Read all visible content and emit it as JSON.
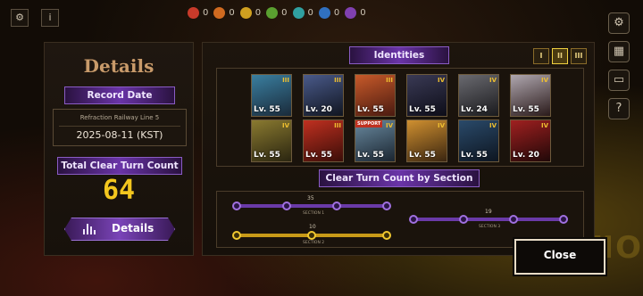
{
  "topbar": {
    "info_label": "i",
    "resources": [
      {
        "icon": "red-gem-icon",
        "value": "0",
        "color": "#c83a2a"
      },
      {
        "icon": "orange-cat-icon",
        "value": "0",
        "color": "#d06a20"
      },
      {
        "icon": "yellow-orb-icon",
        "value": "0",
        "color": "#d0a020"
      },
      {
        "icon": "green-orb-icon",
        "value": "0",
        "color": "#5aa030"
      },
      {
        "icon": "teal-orb-icon",
        "value": "0",
        "color": "#30a0a0"
      },
      {
        "icon": "blue-orb-icon",
        "value": "0",
        "color": "#3070c0"
      },
      {
        "icon": "purple-orb-icon",
        "value": "0",
        "color": "#8040b0"
      }
    ]
  },
  "left": {
    "title": "Details",
    "record_date_label": "Record Date",
    "record_location": "Refraction Railway Line 5",
    "record_date": "2025-08-11 (KST)",
    "total_clear_label": "Total Clear Turn Count",
    "total_clear_value": "64",
    "details_button": "Details"
  },
  "right": {
    "identities_label": "Identities",
    "tiers": [
      "I",
      "II",
      "III"
    ],
    "active_tier": 1,
    "identities": [
      {
        "level": "Lv. 55",
        "rank": "III",
        "support": "",
        "colors": [
          "#3a7fa0",
          "#1a2a3a"
        ]
      },
      {
        "level": "Lv. 20",
        "rank": "III",
        "support": "",
        "colors": [
          "#4a5a8a",
          "#101520"
        ]
      },
      {
        "level": "Lv. 55",
        "rank": "III",
        "support": "",
        "colors": [
          "#c85a2a",
          "#4a1a10"
        ]
      },
      {
        "level": "Lv. 55",
        "rank": "IV",
        "support": "",
        "colors": [
          "#3a3a55",
          "#0d0d18"
        ]
      },
      {
        "level": "Lv. 24",
        "rank": "IV",
        "support": "",
        "colors": [
          "#6a6a70",
          "#1a1a1d"
        ]
      },
      {
        "level": "Lv. 55",
        "rank": "IV",
        "support": "",
        "colors": [
          "#b0a8b0",
          "#2a1a1a"
        ]
      },
      {
        "level": "Lv. 55",
        "rank": "IV",
        "support": "",
        "colors": [
          "#8a7a30",
          "#2a2510"
        ]
      },
      {
        "level": "Lv. 55",
        "rank": "III",
        "support": "",
        "colors": [
          "#c03020",
          "#3a0d08"
        ]
      },
      {
        "level": "Lv. 55",
        "rank": "IV",
        "support": "SUPPORT",
        "colors": [
          "#6a8aa0",
          "#1a2530"
        ]
      },
      {
        "level": "Lv. 55",
        "rank": "IV",
        "support": "",
        "colors": [
          "#d09030",
          "#3a2510"
        ]
      },
      {
        "level": "Lv. 55",
        "rank": "IV",
        "support": "",
        "colors": [
          "#2a4a6a",
          "#0d1520"
        ]
      },
      {
        "level": "Lv. 20",
        "rank": "IV",
        "support": "",
        "colors": [
          "#a02020",
          "#200808"
        ]
      }
    ],
    "section_title": "Clear Turn Count by Section",
    "sections": [
      {
        "turns": "35",
        "label": "SECTION 1",
        "color": "#8a50c8"
      },
      {
        "turns": "19",
        "label": "SECTION 3",
        "color": "#8a50c8"
      },
      {
        "turns": "10",
        "label": "SECTION 2",
        "color": "#e8b820"
      }
    ]
  },
  "background_text": "TIO",
  "close_button": "Close"
}
